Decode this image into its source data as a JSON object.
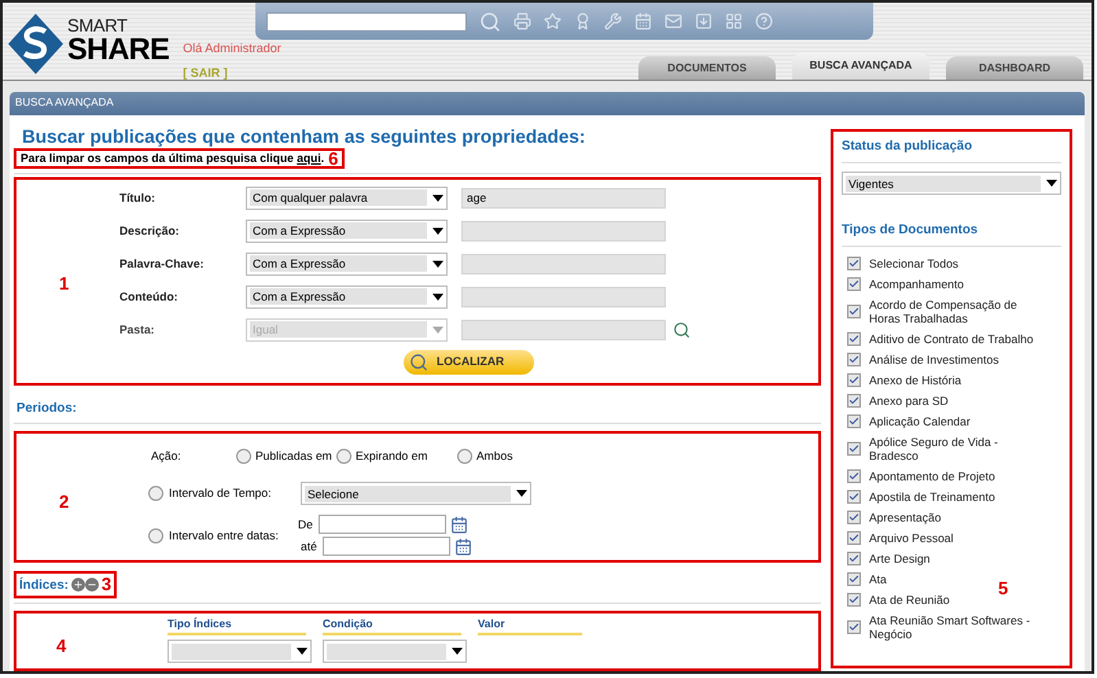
{
  "header": {
    "logo_top": "SMART",
    "logo_bottom": "SHARE",
    "greeting": "Olá Administrador",
    "logout": "[ SAIR ]"
  },
  "tabs": [
    {
      "label": "DOCUMENTOS",
      "selected": false
    },
    {
      "label": "BUSCA AVANÇADA",
      "selected": true
    },
    {
      "label": "DASHBOARD",
      "selected": false
    }
  ],
  "section_bar": "BUSCA AVANÇADA",
  "heading": "Buscar publicações que contenham as seguintes propriedades:",
  "clear_note": {
    "text": "Para limpar os campos da última pesquisa clique",
    "link": "aqui",
    "end": ".",
    "marker": "6"
  },
  "properties": {
    "marker": "1",
    "rows": [
      {
        "label": "Título:",
        "condition": "Com qualquer palavra",
        "value": "age",
        "disabled": false
      },
      {
        "label": "Descrição:",
        "condition": "Com a Expressão",
        "disabled": false
      },
      {
        "label": "Palavra-Chave:",
        "condition": "Com a Expressão",
        "disabled": false
      },
      {
        "label": "Conteúdo:",
        "condition": "Com a Expressão",
        "disabled": false
      },
      {
        "label": "Pasta:",
        "condition": "Igual",
        "disabled": true,
        "kind": "folder"
      }
    ],
    "search_button": "LOCALIZAR"
  },
  "periods": {
    "title": "Periodos:",
    "marker": "2",
    "action_label": "Ação:",
    "actions": [
      {
        "label": "Publicadas em",
        "selected": false
      },
      {
        "label": "Expirando em",
        "selected": false
      },
      {
        "label": "Ambos",
        "selected": false
      }
    ],
    "time_interval": {
      "label": "Intervalo de Tempo:",
      "selected": false,
      "value": "Selecione"
    },
    "date_interval": {
      "label": "Intervalo entre datas:",
      "selected": false,
      "from_label": "De",
      "to_label": "até"
    }
  },
  "indices": {
    "title": "Índices:",
    "marker": "3",
    "table_marker": "4",
    "columns": [
      "Tipo Índices",
      "Condição",
      "Valor"
    ]
  },
  "status": {
    "title": "Status da publicação",
    "value": "Vigentes"
  },
  "doc_types": {
    "title": "Tipos de Documentos",
    "marker": "5",
    "items": [
      {
        "label": "Selecionar Todos",
        "checked": true
      },
      {
        "label": "Acompanhamento",
        "checked": true
      },
      {
        "label": "Acordo de Compensação de Horas Trabalhadas",
        "checked": true
      },
      {
        "label": "Aditivo de Contrato de Trabalho",
        "checked": true
      },
      {
        "label": "Análise de Investimentos",
        "checked": true
      },
      {
        "label": "Anexo de História",
        "checked": true
      },
      {
        "label": "Anexo para SD",
        "checked": true
      },
      {
        "label": "Aplicação Calendar",
        "checked": true
      },
      {
        "label": "Apólice Seguro de Vida - Bradesco",
        "checked": true
      },
      {
        "label": "Apontamento de Projeto",
        "checked": true
      },
      {
        "label": "Apostila de Treinamento",
        "checked": true
      },
      {
        "label": "Apresentação",
        "checked": true
      },
      {
        "label": "Arquivo Pessoal",
        "checked": true
      },
      {
        "label": "Arte Design",
        "checked": true
      },
      {
        "label": "Ata",
        "checked": true
      },
      {
        "label": "Ata de Reunião",
        "checked": true
      },
      {
        "label": "Ata Reunião Smart Softwares - Negócio",
        "checked": true
      }
    ]
  }
}
